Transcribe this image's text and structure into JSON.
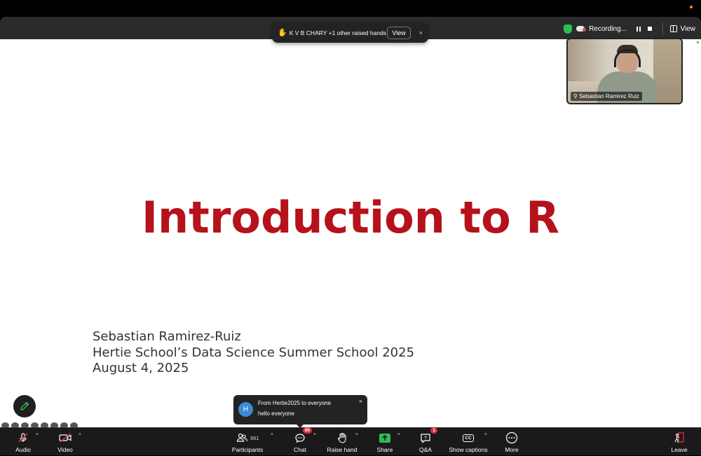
{
  "header": {
    "recording_label": "Recording...",
    "view_label": "View"
  },
  "raised_hands_toast": {
    "hand_icon": "✋",
    "text": "K V B CHARY +1 other raised hands",
    "view_button": "View",
    "close": "×"
  },
  "video_tile": {
    "participant_name": "Sebastian Ramirez Ruiz"
  },
  "slide": {
    "title": "Introduction to R",
    "author": "Sebastian Ramirez-Ruiz",
    "event": "Hertie School’s Data Science Summer School 2025",
    "date": "August 4, 2025",
    "title_color": "#b5121b"
  },
  "chat_toast": {
    "avatar_letter": "H",
    "from": "From Hertie2025 to everyone",
    "message": "hello everyone",
    "close": "×"
  },
  "toolbar": {
    "audio": "Audio",
    "video": "Video",
    "participants": "Participants",
    "participants_count": "391",
    "chat": "Chat",
    "chat_badge": "60",
    "raise_hand": "Raise hand",
    "share": "Share",
    "qa": "Q&A",
    "qa_badge": "1",
    "captions": "Show captions",
    "captions_icon": "CC",
    "more": "More",
    "leave": "Leave",
    "caret": "^",
    "accent_green": "#2dbd54",
    "alert_red": "#e02d3c"
  }
}
